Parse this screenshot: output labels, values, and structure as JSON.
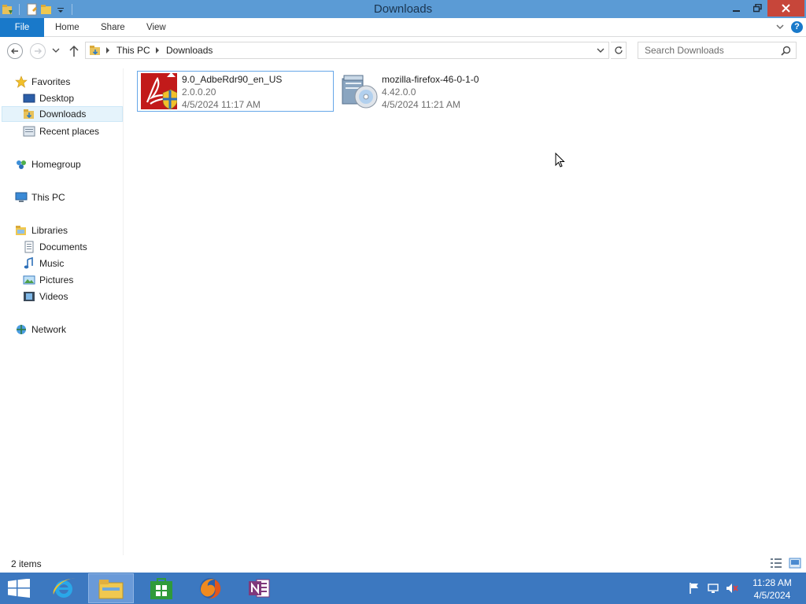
{
  "window": {
    "title": "Downloads"
  },
  "ribbon": {
    "file": "File",
    "home": "Home",
    "share": "Share",
    "view": "View",
    "help": "?"
  },
  "address": {
    "crumbs": [
      "This PC",
      "Downloads"
    ]
  },
  "search": {
    "placeholder": "Search Downloads"
  },
  "sidebar": {
    "favorites": "Favorites",
    "desktop": "Desktop",
    "downloads": "Downloads",
    "recent": "Recent places",
    "homegroup": "Homegroup",
    "thispc": "This PC",
    "libraries": "Libraries",
    "documents": "Documents",
    "music": "Music",
    "pictures": "Pictures",
    "videos": "Videos",
    "network": "Network"
  },
  "files": [
    {
      "name": "9.0_AdbeRdr90_en_US",
      "version": "2.0.0.20",
      "date": "4/5/2024 11:17 AM",
      "icon": "adobe-reader-installer-icon"
    },
    {
      "name": "mozilla-firefox-46-0-1-0",
      "version": "4.42.0.0",
      "date": "4/5/2024 11:21 AM",
      "icon": "installer-disc-icon"
    }
  ],
  "status": {
    "count": "2 items"
  },
  "taskbar": {
    "time": "11:28 AM",
    "date": "4/5/2024"
  },
  "colors": {
    "titlebar": "#5b9bd5",
    "file_tab": "#1979ca",
    "taskbar": "#3c78c0",
    "close": "#c7463a"
  }
}
